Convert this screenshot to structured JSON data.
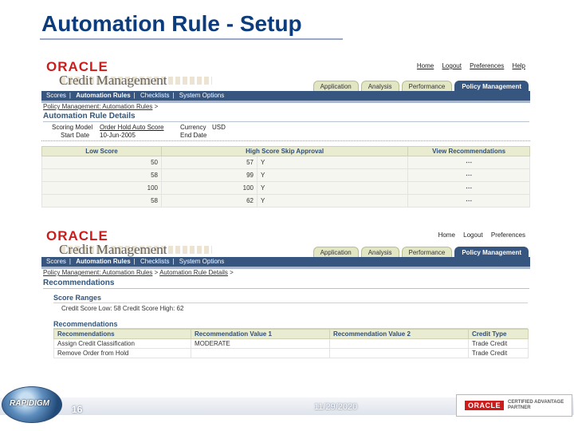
{
  "slide": {
    "title": "Automation Rule - Setup",
    "page_number": "16",
    "date": "11/29/2020",
    "footer_logo_text": "RAPIDIGM",
    "partner_badge": {
      "oracle": "ORACLE",
      "line1": "CERTIFIED ADVANTAGE",
      "line2": "PARTNER"
    }
  },
  "screen1": {
    "logo": {
      "oracle": "ORACLE",
      "product": "Credit Management"
    },
    "global_links": [
      "Home",
      "Logout",
      "Preferences",
      "Help"
    ],
    "tabs": [
      "Application",
      "Analysis",
      "Performance",
      "Policy Management"
    ],
    "active_tab": "Policy Management",
    "subnav": [
      "Scores",
      "Automation Rules",
      "Checklists",
      "System Options"
    ],
    "breadcrumb": {
      "link": "Policy Management: Automation Rules",
      "sep": ">"
    },
    "section_title": "Automation Rule Details",
    "details": {
      "scoring_model_label": "Scoring Model",
      "scoring_model_value": "Order Hold Auto Score",
      "currency_label": "Currency",
      "currency_value": "USD",
      "start_date_label": "Start Date",
      "start_date_value": "10-Jun-2005",
      "end_date_label": "End Date",
      "end_date_value": ""
    },
    "table": {
      "headers": [
        "Low Score",
        "High Score Skip Approval",
        "View Recommendations"
      ],
      "rows": [
        {
          "low": "50",
          "high": "57",
          "skip": "Y",
          "icon": "recommendations-icon"
        },
        {
          "low": "58",
          "high": "99",
          "skip": "Y",
          "icon": "recommendations-icon"
        },
        {
          "low": "100",
          "high": "100",
          "skip": "Y",
          "icon": "recommendations-icon"
        },
        {
          "low": "58",
          "high": "62",
          "skip": "Y",
          "icon": "recommendations-icon"
        }
      ]
    }
  },
  "screen2": {
    "logo": {
      "oracle": "ORACLE",
      "product": "Credit Management"
    },
    "global_links": [
      "Home",
      "Logout",
      "Preferences"
    ],
    "tabs": [
      "Application",
      "Analysis",
      "Performance",
      "Policy Management"
    ],
    "active_tab": "Policy Management",
    "subnav": [
      "Scores",
      "Automation Rules",
      "Checklists",
      "System Options"
    ],
    "breadcrumb": {
      "link1": "Policy Management: Automation Rules",
      "link2": "Automation Rule Details",
      "sep": ">"
    },
    "section_title": "Recommendations",
    "score_ranges": {
      "title": "Score Ranges",
      "line": "Credit Score Low: 58   Credit Score High: 62"
    },
    "recommendations": {
      "title": "Recommendations",
      "headers": [
        "Recommendations",
        "Recommendation Value 1",
        "Recommendation Value 2",
        "Credit Type"
      ],
      "rows": [
        {
          "rec": "Assign Credit Classification",
          "v1": "MODERATE",
          "v2": "",
          "type": "Trade Credit"
        },
        {
          "rec": "Remove Order from Hold",
          "v1": "",
          "v2": "",
          "type": "Trade Credit"
        }
      ]
    }
  }
}
